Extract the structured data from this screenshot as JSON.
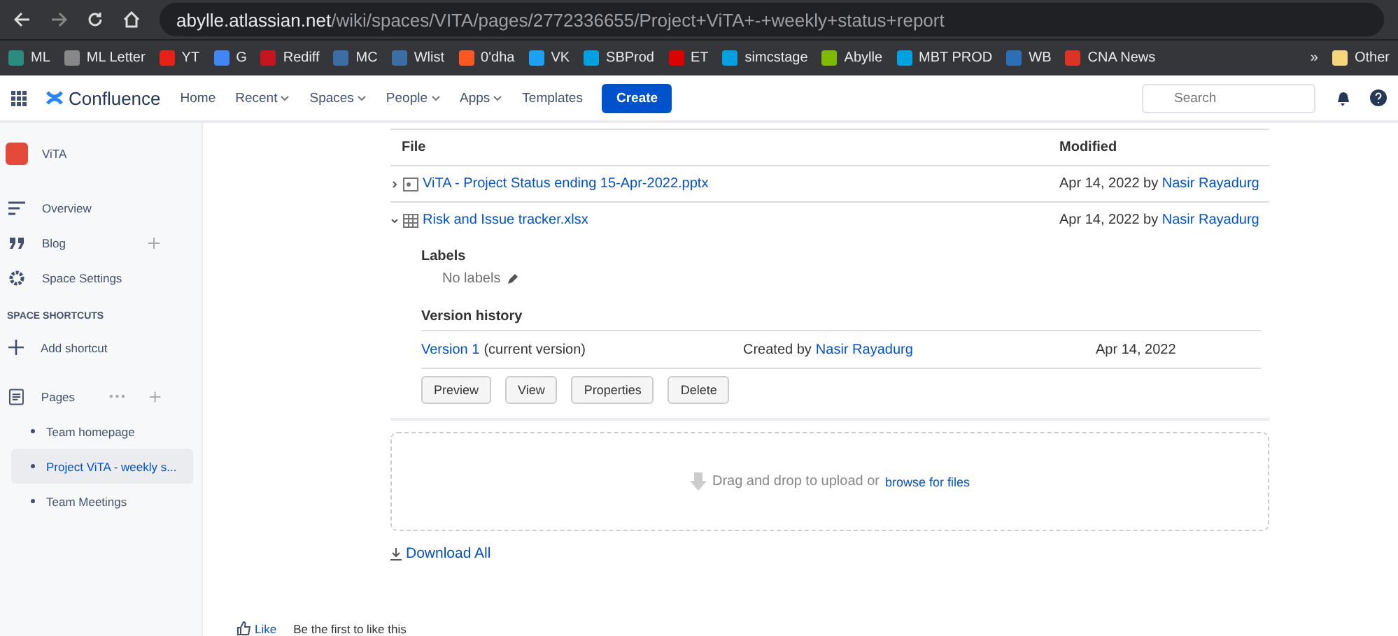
{
  "browser": {
    "url_host": "abylle.atlassian.net",
    "url_path": "/wiki/spaces/VITA/pages/2772336655/Project+ViTA+-+weekly+status+report",
    "bookmarks": [
      {
        "label": "ML"
      },
      {
        "label": "ML Letter"
      },
      {
        "label": "YT"
      },
      {
        "label": "G"
      },
      {
        "label": "Rediff"
      },
      {
        "label": "MC"
      },
      {
        "label": "Wlist"
      },
      {
        "label": "0'dha"
      },
      {
        "label": "VK"
      },
      {
        "label": "SBProd"
      },
      {
        "label": "ET"
      },
      {
        "label": "simcstage"
      },
      {
        "label": "Abylle"
      },
      {
        "label": "MBT PROD"
      },
      {
        "label": "WB"
      },
      {
        "label": "CNA News"
      }
    ],
    "overflow": "»",
    "other": "Other"
  },
  "nav": {
    "product": "Confluence",
    "items": [
      {
        "label": "Home",
        "dropdown": false
      },
      {
        "label": "Recent",
        "dropdown": true
      },
      {
        "label": "Spaces",
        "dropdown": true
      },
      {
        "label": "People",
        "dropdown": true
      },
      {
        "label": "Apps",
        "dropdown": true
      },
      {
        "label": "Templates",
        "dropdown": false
      }
    ],
    "create": "Create",
    "search": {
      "placeholder": "Search"
    }
  },
  "sidebar": {
    "space": "ViTA",
    "items": [
      {
        "label": "Overview",
        "kind": "overview",
        "addable": false
      },
      {
        "label": "Blog",
        "kind": "blog",
        "addable": true
      },
      {
        "label": "Space Settings",
        "kind": "settings",
        "addable": false
      }
    ],
    "shortcuts_heading": "SPACE SHORTCUTS",
    "add_shortcut": "Add shortcut",
    "pages_label": "Pages",
    "pages": [
      {
        "label": "Team homepage",
        "selected": false
      },
      {
        "label": "Project ViTA - weekly s...",
        "selected": true
      },
      {
        "label": "Team Meetings",
        "selected": false
      }
    ]
  },
  "attachments": {
    "columns": [
      "File",
      "Modified"
    ],
    "rows": [
      {
        "name": "ViTA - Project Status ending 15-Apr-2022.pptx",
        "kind": "presentation",
        "expanded": false,
        "date": "Apr 14, 2022 by",
        "author": "Nasir Rayadurg"
      },
      {
        "name": "Risk and Issue tracker.xlsx",
        "kind": "spreadsheet",
        "expanded": true,
        "date": "Apr 14, 2022 by",
        "author": "Nasir Rayadurg",
        "details": {
          "labels_heading": "Labels",
          "no_labels": "No labels",
          "history_heading": "Version history",
          "versions": [
            {
              "version": "Version 1",
              "note": "(current version)",
              "created": "Created by",
              "author": "Nasir Rayadurg",
              "date": "Apr 14, 2022"
            }
          ],
          "buttons": [
            "Preview",
            "View",
            "Properties",
            "Delete"
          ]
        }
      }
    ],
    "upload": {
      "text": "Drag and drop to upload or",
      "link": "browse for files"
    },
    "download_all": "Download All"
  },
  "like": {
    "label": "Like",
    "note": "Be the first to like this"
  }
}
